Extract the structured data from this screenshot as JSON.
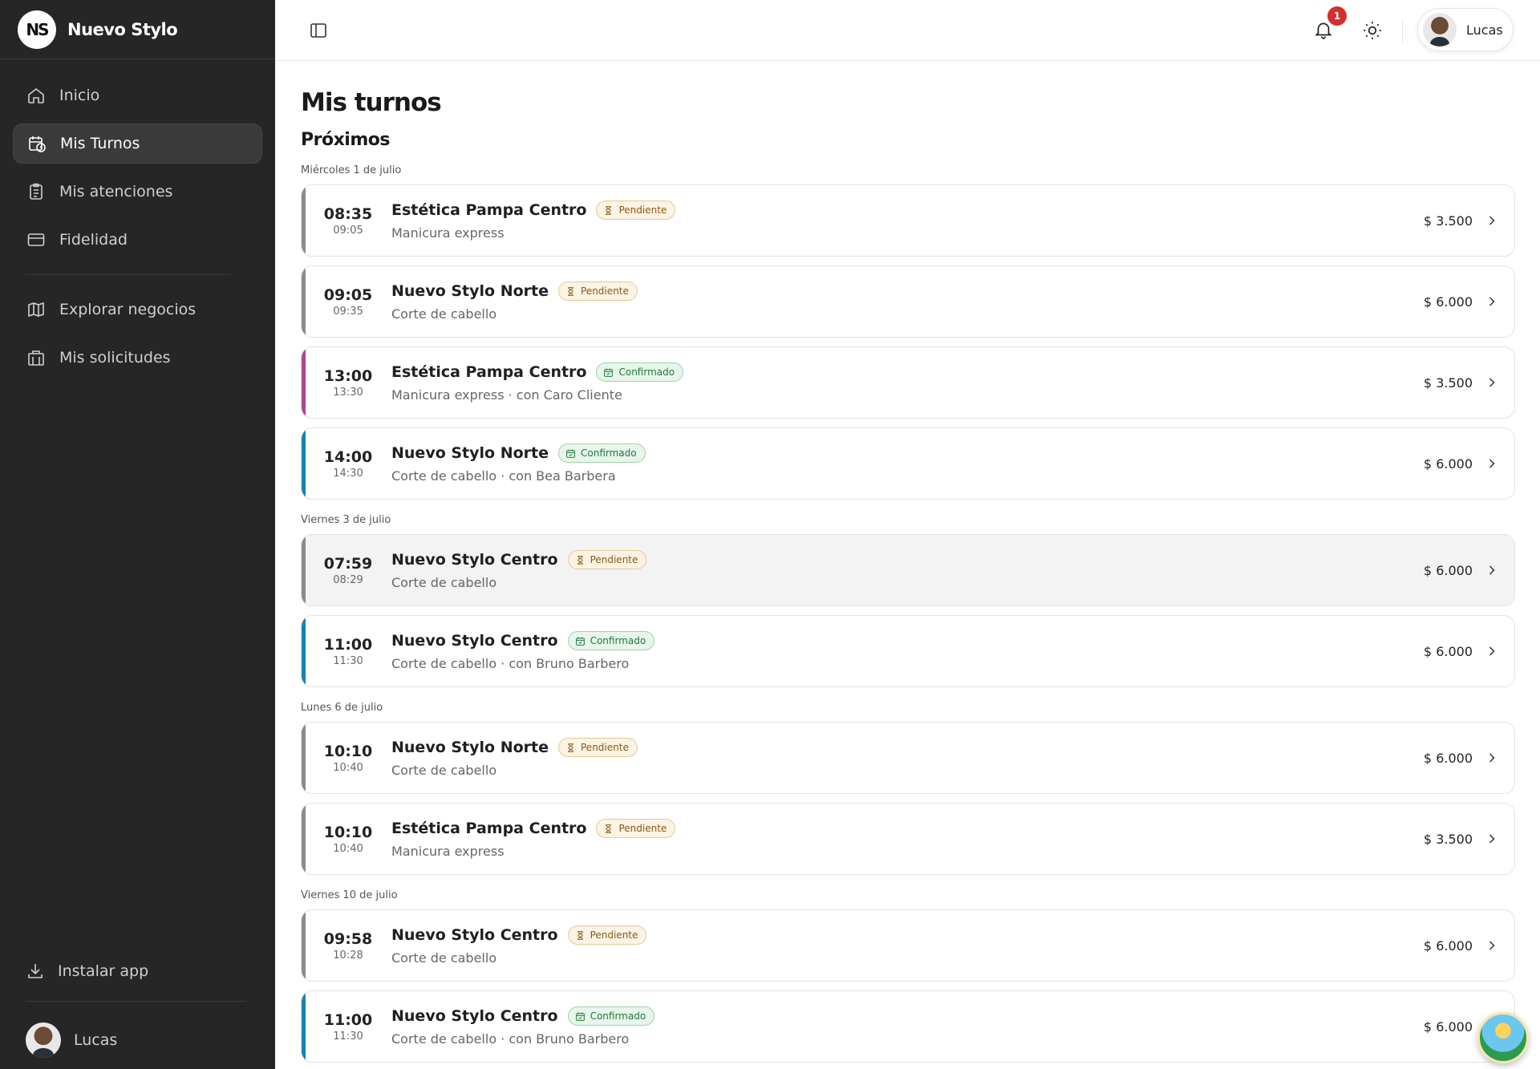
{
  "brand": {
    "logo_text": "NS",
    "name": "Nuevo Stylo"
  },
  "sidebar": {
    "items": [
      {
        "label": "Inicio",
        "icon": "home-icon"
      },
      {
        "label": "Mis Turnos",
        "icon": "calendar-clock-icon"
      },
      {
        "label": "Mis atenciones",
        "icon": "clipboard-icon"
      },
      {
        "label": "Fidelidad",
        "icon": "card-icon"
      },
      {
        "label": "Explorar negocios",
        "icon": "map-icon"
      },
      {
        "label": "Mis solicitudes",
        "icon": "building-icon"
      }
    ],
    "active_index": 1,
    "install_label": "Instalar app",
    "user_name": "Lucas"
  },
  "topbar": {
    "notification_count": "1",
    "user_name": "Lucas"
  },
  "main": {
    "title": "Mis turnos",
    "section": "Próximos",
    "days": [
      {
        "label": "Miércoles 1 de julio",
        "appointments": [
          {
            "start": "08:35",
            "end": "09:05",
            "business": "Estética Pampa Centro",
            "status": "Pendiente",
            "status_type": "pending",
            "service": "Manicura express",
            "price": "$ 3.500",
            "accent": "#8a8a8a"
          },
          {
            "start": "09:05",
            "end": "09:35",
            "business": "Nuevo Stylo Norte",
            "status": "Pendiente",
            "status_type": "pending",
            "service": "Corte de cabello",
            "price": "$ 6.000",
            "accent": "#8a8a8a"
          },
          {
            "start": "13:00",
            "end": "13:30",
            "business": "Estética Pampa Centro",
            "status": "Confirmado",
            "status_type": "confirmed",
            "service": "Manicura express · con Caro Cliente",
            "price": "$ 3.500",
            "accent": "#b0458f"
          },
          {
            "start": "14:00",
            "end": "14:30",
            "business": "Nuevo Stylo Norte",
            "status": "Confirmado",
            "status_type": "confirmed",
            "service": "Corte de cabello · con Bea Barbera",
            "price": "$ 6.000",
            "accent": "#1a7fb8"
          }
        ]
      },
      {
        "label": "Viernes 3 de julio",
        "appointments": [
          {
            "start": "07:59",
            "end": "08:29",
            "business": "Nuevo Stylo Centro",
            "status": "Pendiente",
            "status_type": "pending",
            "service": "Corte de cabello",
            "price": "$ 6.000",
            "accent": "#8a8a8a",
            "highlight": true
          },
          {
            "start": "11:00",
            "end": "11:30",
            "business": "Nuevo Stylo Centro",
            "status": "Confirmado",
            "status_type": "confirmed",
            "service": "Corte de cabello · con Bruno Barbero",
            "price": "$ 6.000",
            "accent": "#1a7fb8"
          }
        ]
      },
      {
        "label": "Lunes 6 de julio",
        "appointments": [
          {
            "start": "10:10",
            "end": "10:40",
            "business": "Nuevo Stylo Norte",
            "status": "Pendiente",
            "status_type": "pending",
            "service": "Corte de cabello",
            "price": "$ 6.000",
            "accent": "#8a8a8a"
          },
          {
            "start": "10:10",
            "end": "10:40",
            "business": "Estética Pampa Centro",
            "status": "Pendiente",
            "status_type": "pending",
            "service": "Manicura express",
            "price": "$ 3.500",
            "accent": "#8a8a8a"
          }
        ]
      },
      {
        "label": "Viernes 10 de julio",
        "appointments": [
          {
            "start": "09:58",
            "end": "10:28",
            "business": "Nuevo Stylo Centro",
            "status": "Pendiente",
            "status_type": "pending",
            "service": "Corte de cabello",
            "price": "$ 6.000",
            "accent": "#8a8a8a"
          },
          {
            "start": "11:00",
            "end": "11:30",
            "business": "Nuevo Stylo Centro",
            "status": "Confirmado",
            "status_type": "confirmed",
            "service": "Corte de cabello · con Bruno Barbero",
            "price": "$ 6.000",
            "accent": "#1a7fb8"
          }
        ]
      }
    ]
  }
}
